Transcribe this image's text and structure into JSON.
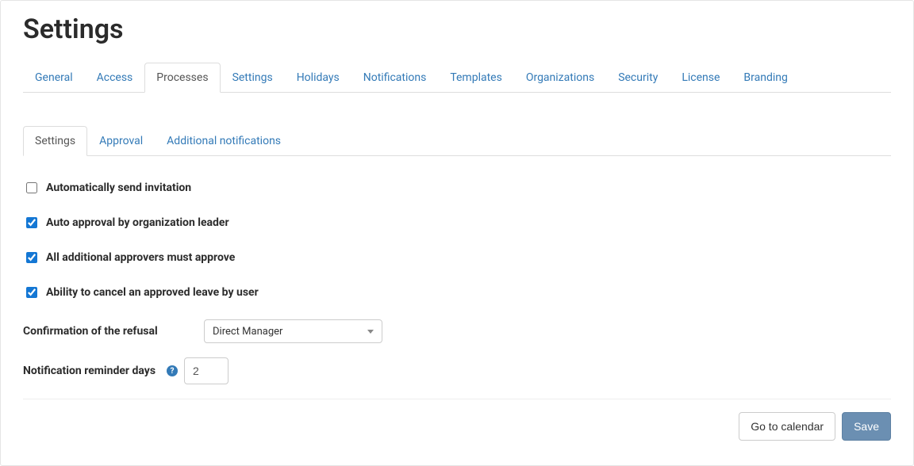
{
  "pageTitle": "Settings",
  "primaryTabs": [
    {
      "label": "General"
    },
    {
      "label": "Access"
    },
    {
      "label": "Processes"
    },
    {
      "label": "Settings"
    },
    {
      "label": "Holidays"
    },
    {
      "label": "Notifications"
    },
    {
      "label": "Templates"
    },
    {
      "label": "Organizations"
    },
    {
      "label": "Security"
    },
    {
      "label": "License"
    },
    {
      "label": "Branding"
    }
  ],
  "primaryActiveIndex": 2,
  "secondaryTabs": [
    {
      "label": "Settings"
    },
    {
      "label": "Approval"
    },
    {
      "label": "Additional notifications"
    }
  ],
  "secondaryActiveIndex": 0,
  "checks": {
    "autoInvite": "Automatically send invitation",
    "autoApprove": "Auto approval by organization leader",
    "allApprove": "All additional approvers must approve",
    "cancelApproved": "Ability to cancel an approved leave by user"
  },
  "checksState": {
    "autoInvite": false,
    "autoApprove": true,
    "allApprove": true,
    "cancelApproved": true
  },
  "confirmRefusal": {
    "label": "Confirmation of the refusal",
    "value": "Direct Manager"
  },
  "reminder": {
    "label": "Notification reminder days",
    "value": "2"
  },
  "buttons": {
    "calendar": "Go to calendar",
    "save": "Save"
  }
}
